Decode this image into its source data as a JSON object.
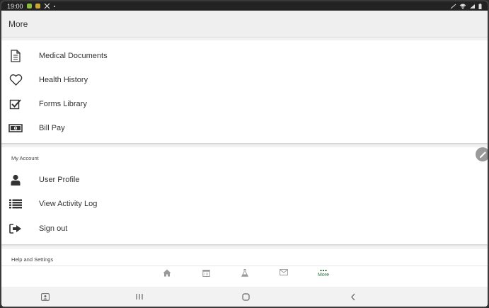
{
  "status_bar": {
    "time": "19:00"
  },
  "app_bar": {
    "title": "More"
  },
  "menu": {
    "items": [
      {
        "label": "Medical Documents",
        "icon": "document-icon"
      },
      {
        "label": "Health History",
        "icon": "heart-icon"
      },
      {
        "label": "Forms Library",
        "icon": "checkbox-icon"
      },
      {
        "label": "Bill Pay",
        "icon": "money-icon"
      }
    ]
  },
  "my_account": {
    "title": "My Account",
    "items": [
      {
        "label": "User Profile",
        "icon": "user-icon"
      },
      {
        "label": "View Activity Log",
        "icon": "list-icon"
      },
      {
        "label": "Sign out",
        "icon": "sign-out-icon"
      }
    ]
  },
  "help_settings": {
    "title": "Help and Settings"
  },
  "tab_bar": {
    "tabs": [
      {
        "name": "home",
        "icon": "home-icon"
      },
      {
        "name": "calendar",
        "icon": "calendar-icon"
      },
      {
        "name": "lab",
        "icon": "flask-icon"
      },
      {
        "name": "messages",
        "icon": "mail-icon"
      },
      {
        "name": "more",
        "icon": "more-dots-icon",
        "label": "More",
        "active": true
      }
    ],
    "active_color": "#2e6b3c"
  },
  "colors": {
    "icon": "#333333",
    "inactive_tab": "#9a9a9a"
  }
}
